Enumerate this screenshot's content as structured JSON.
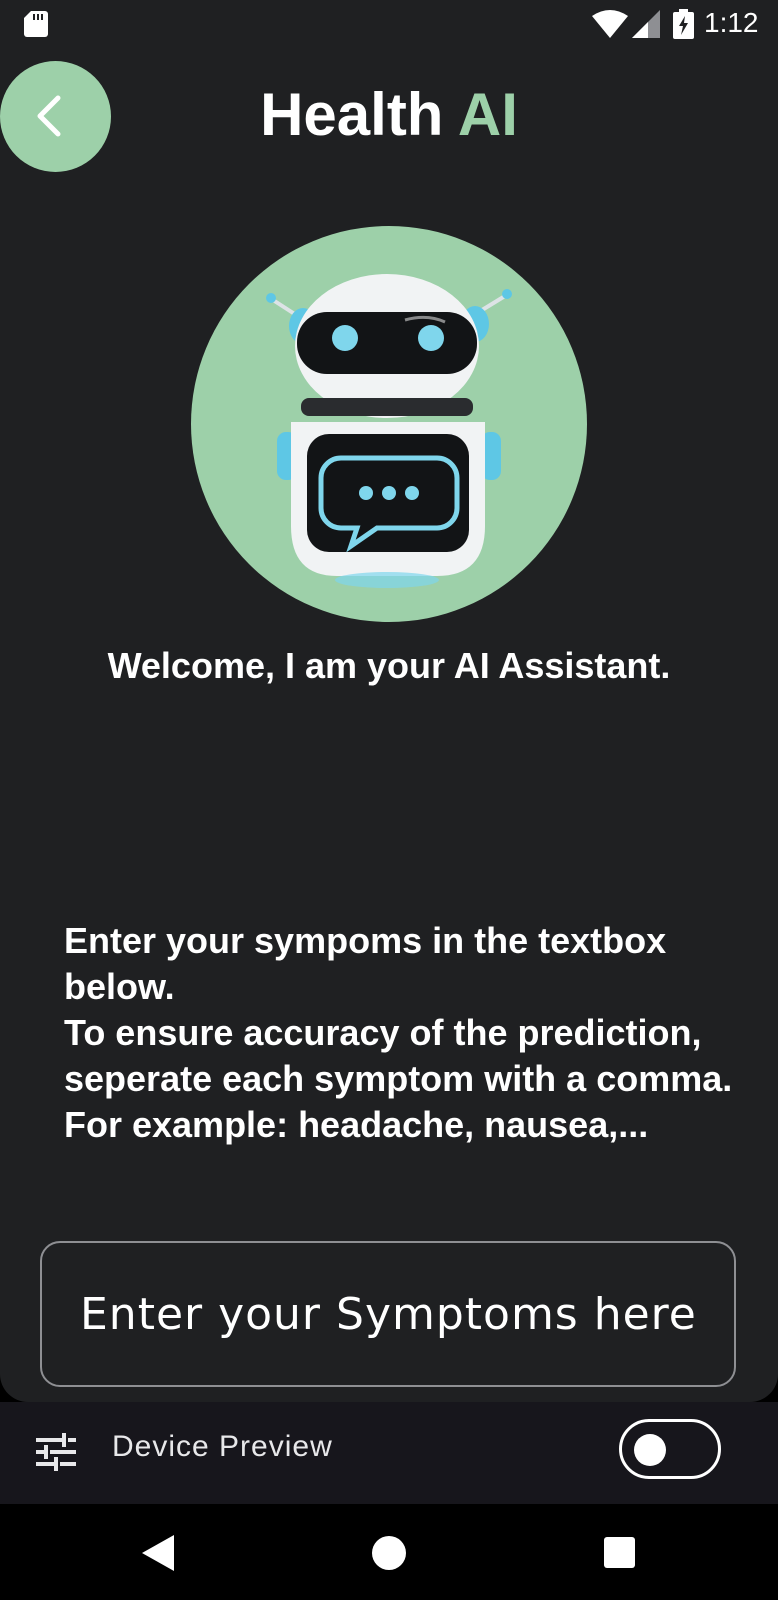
{
  "status_bar": {
    "time": "1:12",
    "icons": [
      "sd-card-icon",
      "wifi-icon",
      "cell-signal-icon",
      "battery-charging-icon"
    ]
  },
  "header": {
    "title_primary": "Health",
    "title_accent": "AI",
    "back_icon": "chevron-left-icon"
  },
  "colors": {
    "accent": "#9dd0a9",
    "background": "#1f2022",
    "preview_bar": "#17161c"
  },
  "assistant": {
    "avatar_icon": "robot-icon",
    "welcome": "Welcome, I am your AI Assistant."
  },
  "instructions": {
    "line1": "Enter your sympoms in the textbox below.",
    "line2": "To ensure accuracy of the prediction, seperate each symptom with a comma.",
    "line3": "For example: headache, nausea,..."
  },
  "symptom_input": {
    "placeholder": "Enter your Symptoms here",
    "value": ""
  },
  "device_preview": {
    "icon": "tune-icon",
    "label": "Device Preview",
    "toggle_on": false
  },
  "nav_bar": {
    "icons": [
      "nav-back-icon",
      "nav-home-icon",
      "nav-recents-icon"
    ]
  }
}
